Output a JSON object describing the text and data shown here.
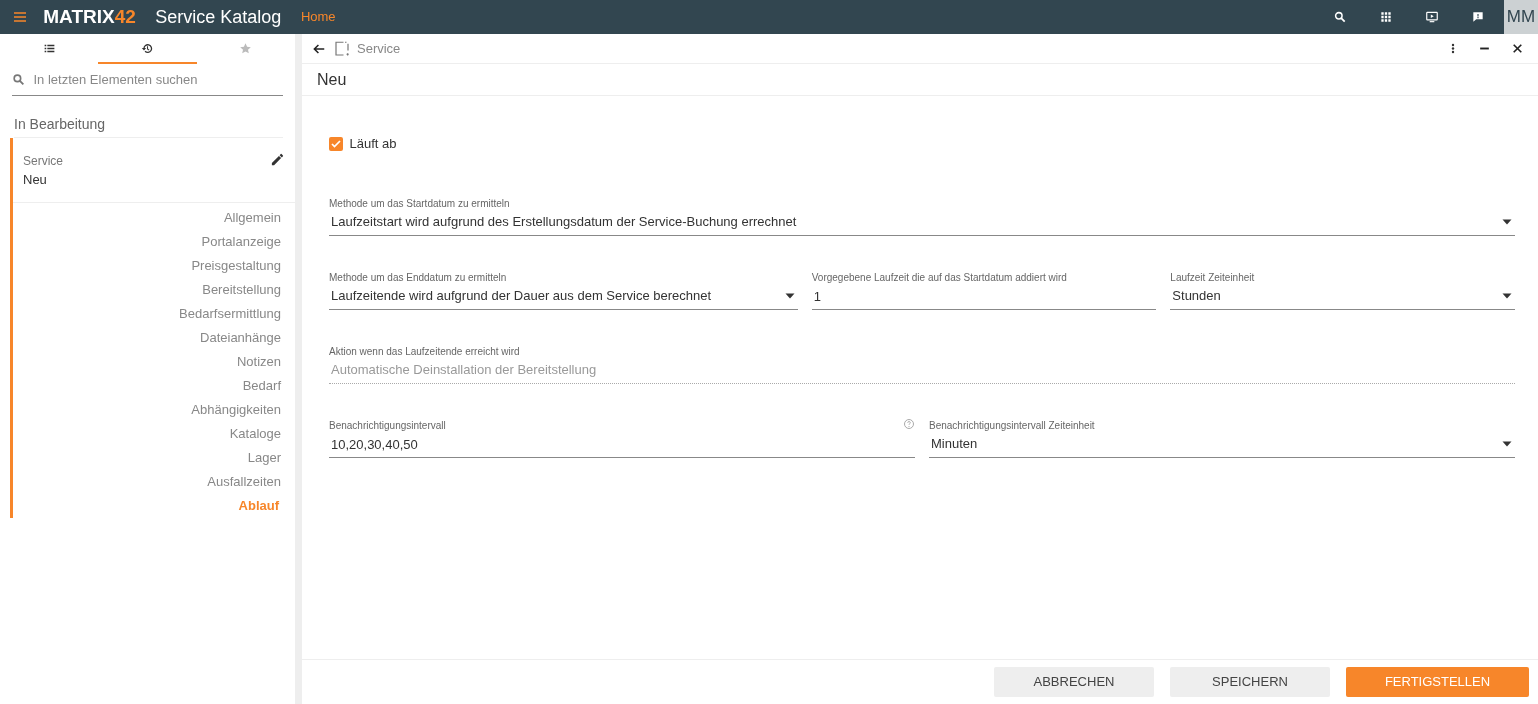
{
  "app_bar": {
    "logo": {
      "text": "MATRIX",
      "accent": "42"
    },
    "title": "Service Katalog",
    "nav": [
      {
        "label": "Home",
        "selected": true
      }
    ],
    "user_initials": "MM"
  },
  "sidebar": {
    "tabs": [
      {
        "selected": false
      },
      {
        "selected": true
      },
      {
        "selected": false
      }
    ],
    "search": {
      "placeholder": "In letzten Elementen suchen"
    },
    "section_title": "In Bearbeitung",
    "item": {
      "type": "Service",
      "name": "Neu"
    },
    "nav_items": [
      {
        "label": "Allgemein",
        "selected": false
      },
      {
        "label": "Portalanzeige",
        "selected": false
      },
      {
        "label": "Preisgestaltung",
        "selected": false
      },
      {
        "label": "Bereitstellung",
        "selected": false
      },
      {
        "label": "Bedarfsermittlung",
        "selected": false
      },
      {
        "label": "Dateianhänge",
        "selected": false
      },
      {
        "label": "Notizen",
        "selected": false
      },
      {
        "label": "Bedarf",
        "selected": false
      },
      {
        "label": "Abhängigkeiten",
        "selected": false
      },
      {
        "label": "Kataloge",
        "selected": false
      },
      {
        "label": "Lager",
        "selected": false
      },
      {
        "label": "Ausfallzeiten",
        "selected": false
      },
      {
        "label": "Ablauf",
        "selected": true
      }
    ]
  },
  "panel": {
    "breadcrumb": "Service",
    "title": "Neu",
    "checkbox": {
      "label": "Läuft ab",
      "checked": true
    },
    "rows": [
      [
        {
          "kind": "select",
          "label": "Methode um das Startdatum zu ermitteln",
          "value": "Laufzeitstart wird aufgrund des Erstellungsdatum der Service-Buchung errechnet"
        }
      ],
      [
        {
          "kind": "select",
          "label": "Methode um das Enddatum zu ermitteln",
          "value": "Laufzeitende wird aufgrund der Dauer aus dem Service berechnet"
        },
        {
          "kind": "input",
          "label": "Vorgegebene Laufzeit die auf das Startdatum addiert wird",
          "value": "1"
        },
        {
          "kind": "select",
          "label": "Laufzeit Zeiteinheit",
          "value": "Stunden"
        }
      ],
      [
        {
          "kind": "readonly",
          "disabled": true,
          "label": "Aktion wenn das Laufzeitende erreicht wird",
          "value": "Automatische Deinstallation der Bereitstellung"
        }
      ],
      [
        {
          "kind": "input",
          "label": "Benachrichtigungsintervall",
          "value": "10,20,30,40,50",
          "help": true
        },
        {
          "kind": "select",
          "label": "Benachrichtigungsintervall Zeiteinheit",
          "value": "Minuten"
        }
      ]
    ],
    "buttons": [
      {
        "label": "ABBRECHEN",
        "kind": "secondary"
      },
      {
        "label": "SPEICHERN",
        "kind": "secondary"
      },
      {
        "label": "FERTIGSTELLEN",
        "kind": "primary"
      }
    ]
  }
}
